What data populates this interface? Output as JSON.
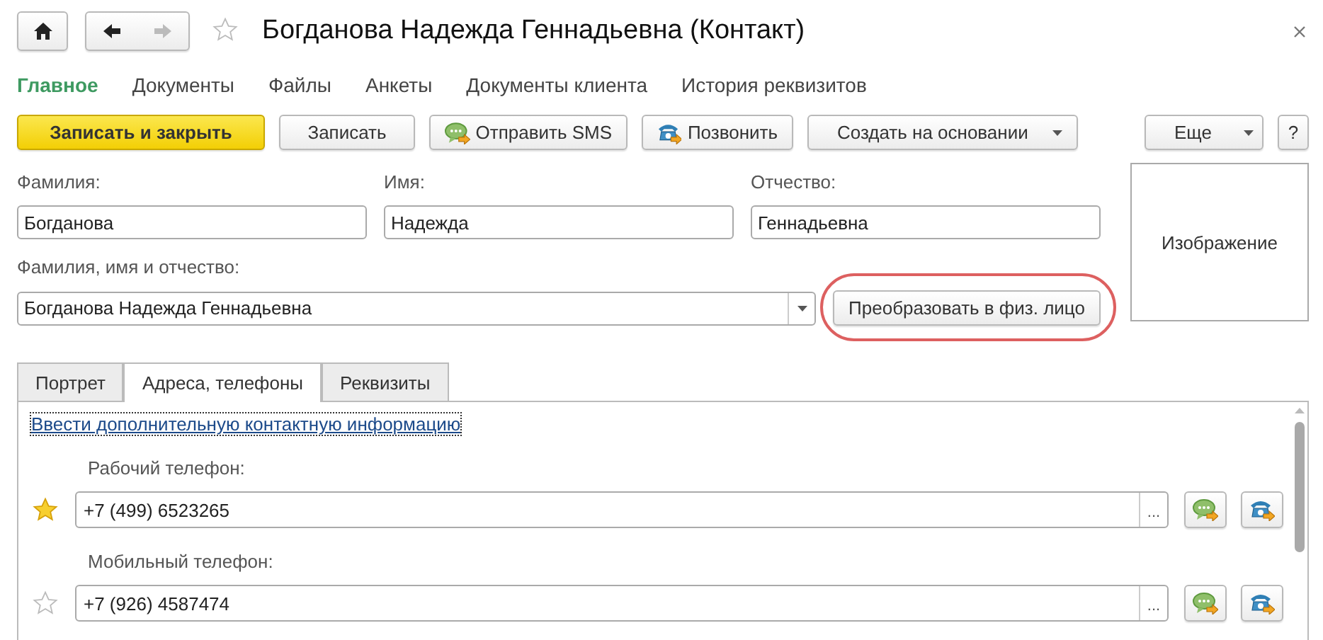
{
  "window": {
    "title": "Богданова Надежда Геннадьевна (Контакт)",
    "favorite": false
  },
  "nav_buttons": [
    {
      "kind": "back",
      "disabled": false
    },
    {
      "kind": "forward",
      "disabled": true
    }
  ],
  "sections": [
    {
      "label": "Главное",
      "selected": true
    },
    {
      "label": "Документы",
      "selected": false
    },
    {
      "label": "Файлы",
      "selected": false
    },
    {
      "label": "Анкеты",
      "selected": false
    },
    {
      "label": "Документы клиента",
      "selected": false
    },
    {
      "label": "История реквизитов",
      "selected": false
    }
  ],
  "toolbar_left": [
    {
      "label": "Записать и закрыть",
      "kind": "primary"
    },
    {
      "label": "Записать",
      "kind": "plain"
    },
    {
      "label": "Отправить SMS",
      "kind": "sms"
    },
    {
      "label": "Позвонить",
      "kind": "call"
    },
    {
      "label": "Создать на основании",
      "kind": "menu"
    }
  ],
  "toolbar_right": [
    {
      "label": "Еще",
      "kind": "menu"
    },
    {
      "label": "?",
      "kind": "plain"
    }
  ],
  "name_fields": [
    {
      "label": "Фамилия:",
      "value": "Богданова"
    },
    {
      "label": "Имя:",
      "value": "Надежда"
    },
    {
      "label": "Отчество:",
      "value": "Геннадьевна"
    }
  ],
  "full_name": {
    "label": "Фамилия, имя и отчество:",
    "value": "Богданова Надежда Геннадьевна"
  },
  "convert_button": {
    "label": "Преобразовать в физ. лицо",
    "highlighted": true
  },
  "image_box": {
    "text": "Изображение"
  },
  "tabs": [
    {
      "label": "Портрет",
      "selected": false
    },
    {
      "label": "Адреса, телефоны",
      "selected": true
    },
    {
      "label": "Реквизиты",
      "selected": false
    }
  ],
  "tab_panel": {
    "link": "Ввести дополнительную контактную информацию",
    "contacts": [
      {
        "label": "Рабочий телефон:",
        "value": "+7 (499) 6523265",
        "main": true,
        "choice_button": "..."
      },
      {
        "label": "Мобильный телефон:",
        "value": "+7 (926) 4587474",
        "main": false,
        "choice_button": "..."
      }
    ]
  }
}
